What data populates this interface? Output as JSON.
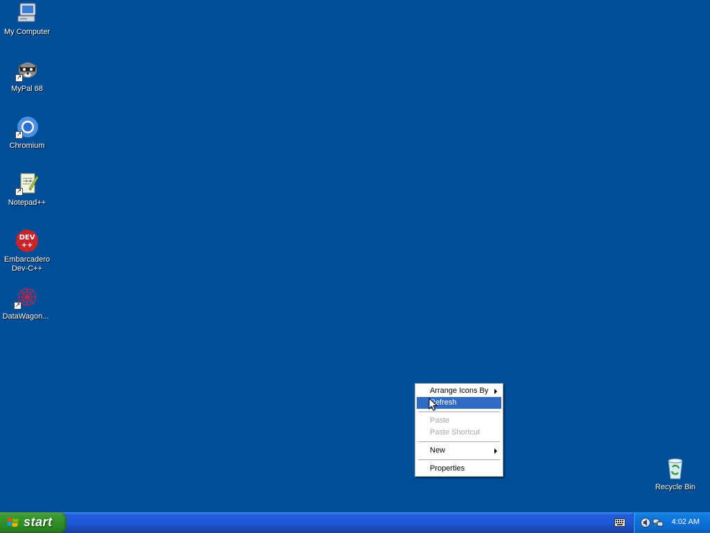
{
  "desktop": {
    "background_color": "#004e98",
    "icons": [
      {
        "label": "My Computer",
        "icon": "my-computer-icon"
      },
      {
        "label": "MyPal 68",
        "icon": "raccoon-icon",
        "shortcut": true
      },
      {
        "label": "Chromium",
        "icon": "chromium-icon",
        "shortcut": true
      },
      {
        "label": "Notepad++",
        "icon": "notepad-plus-plus-icon",
        "shortcut": true
      },
      {
        "label": "Embarcadero Dev-C++",
        "icon": "dev-cpp-icon",
        "shortcut": true
      },
      {
        "label": "DataWagon...",
        "icon": "datawagon-icon",
        "shortcut": true
      }
    ],
    "recycle_bin": {
      "label": "Recycle Bin",
      "icon": "recycle-bin-icon"
    }
  },
  "context_menu": {
    "items": [
      {
        "label": "Arrange Icons By",
        "submenu": true,
        "state": "normal"
      },
      {
        "label": "Refresh",
        "state": "highlighted"
      },
      {
        "label": "Paste",
        "state": "disabled"
      },
      {
        "label": "Paste Shortcut",
        "state": "disabled"
      },
      {
        "label": "New",
        "submenu": true,
        "state": "normal"
      },
      {
        "label": "Properties",
        "state": "normal"
      }
    ],
    "highlight_color": "#316ac5"
  },
  "taskbar": {
    "start_label": "start",
    "clock": "4:02 AM",
    "tray_icons": [
      "keyboard-icon",
      "audio-icon",
      "network-icon"
    ]
  }
}
